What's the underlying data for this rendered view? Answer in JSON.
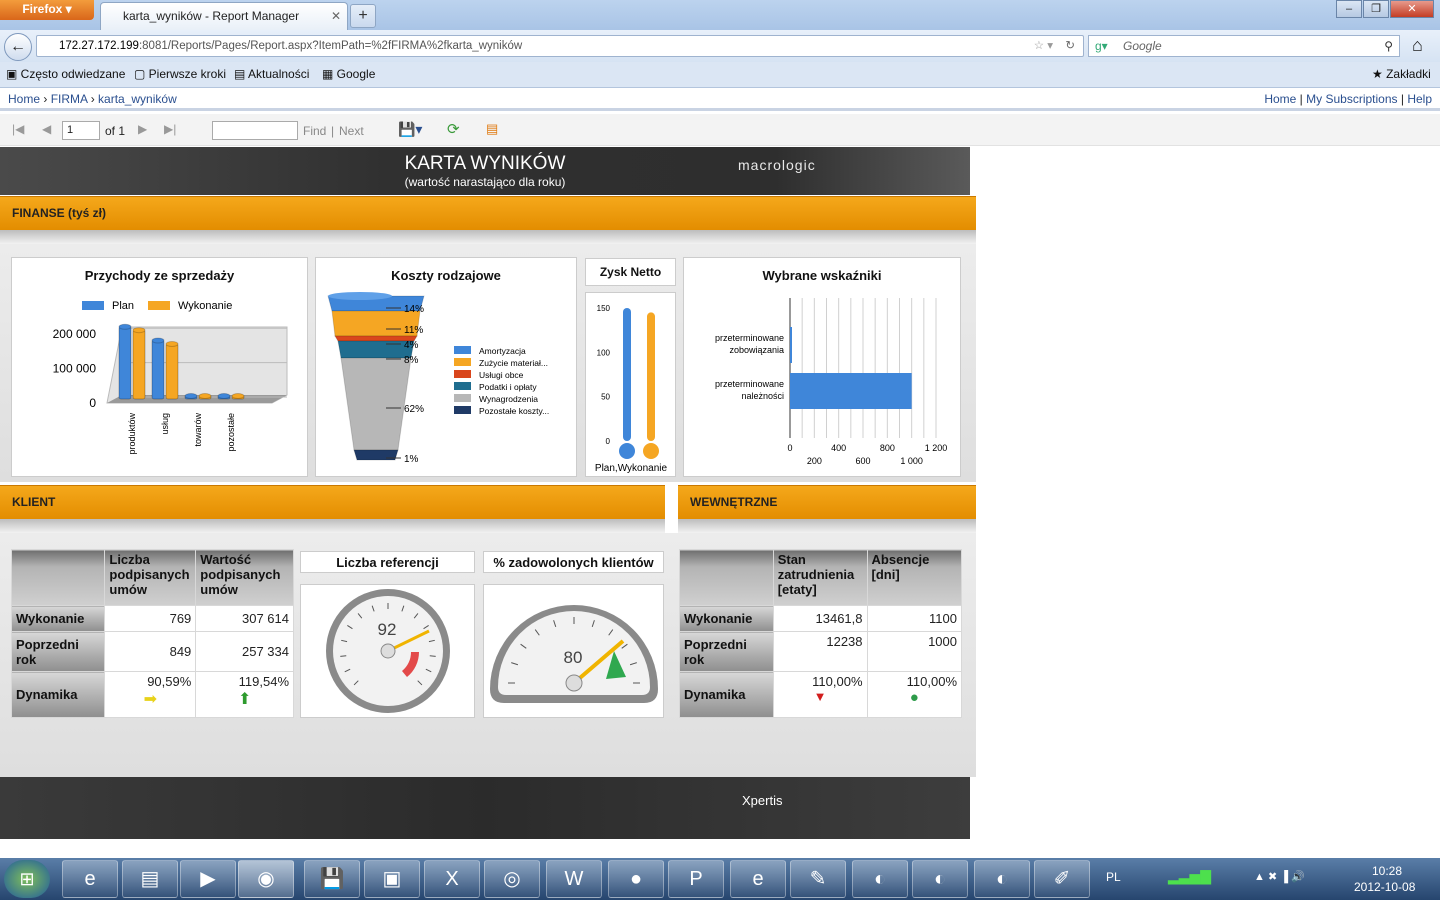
{
  "browser": {
    "app_button": "Firefox",
    "tab_title": "karta_wyników - Report Manager",
    "url_host": "172.27.172.199",
    "url_rest": ":8081/Reports/Pages/Report.aspx?ItemPath=%2fFIRMA%2fkarta_wyników",
    "search_placeholder": "Google",
    "bookmarks": [
      "Często odwiedzane",
      "Pierwsze kroki",
      "Aktualności",
      "Google"
    ],
    "bookmarks_menu": "Zakładki"
  },
  "rm": {
    "breadcrumb": [
      "Home",
      "FIRMA",
      "karta_wyników"
    ],
    "links": [
      "Home",
      "My Subscriptions",
      "Help"
    ],
    "page_value": "1",
    "of_label": "of 1",
    "find_label": "Find",
    "next_label": "Next"
  },
  "report": {
    "title": "KARTA WYNIKÓW",
    "subtitle": "(wartość narastająco dla roku)",
    "logo": "macrologic",
    "footer_logo": "Xpertis",
    "sections": {
      "finanse": "FINANSE (tyś zł)",
      "klient": "KLIENT",
      "wewnetrzne": "WEWNĘTRZNE"
    }
  },
  "colors": {
    "plan": "#3f86d9",
    "wykonanie": "#f5a623",
    "orange_band": "#eb9a0a"
  },
  "chart_data": [
    {
      "type": "bar",
      "title": "Przychody ze sprzedaży",
      "categories": [
        "produktów",
        "usług",
        "towarów",
        "pozostałe"
      ],
      "series": [
        {
          "name": "Plan",
          "values": [
            210000,
            170000,
            5000,
            5000
          ]
        },
        {
          "name": "Wykonanie",
          "values": [
            200000,
            160000,
            4000,
            4000
          ]
        }
      ],
      "yticks": [
        "200 000",
        "100 000",
        "0"
      ],
      "ylim": [
        0,
        250000
      ]
    },
    {
      "type": "funnel",
      "title": "Koszty rodzajowe",
      "labels": [
        "Amortyzacja",
        "Zużycie materiał...",
        "Usługi obce",
        "Podatki i opłaty",
        "Wynagrodzenia",
        "Pozostałe  koszty..."
      ],
      "values": [
        14,
        11,
        4,
        8,
        62,
        1
      ],
      "value_labels": [
        "14%",
        "11%",
        "4%",
        "8%",
        "62%",
        "1%"
      ],
      "colors": [
        "#3f86d9",
        "#f5a623",
        "#d9461c",
        "#1f6d8f",
        "#b7b7b7",
        "#1f3a66"
      ]
    },
    {
      "type": "bar",
      "title": "Zysk Netto",
      "categories": [
        "Plan",
        "Wykonanie"
      ],
      "values": [
        150,
        145
      ],
      "yticks": [
        "150",
        "100",
        "50",
        "0"
      ],
      "ylim": [
        0,
        150
      ],
      "xlabel": "Plan,Wykonanie"
    },
    {
      "type": "bar",
      "orientation": "horizontal",
      "title": "Wybrane wskaźniki",
      "categories": [
        "przeterminowane zobowiązania",
        "przeterminowane należności"
      ],
      "values": [
        5,
        1000
      ],
      "xticks_top": [
        "0",
        "400",
        "800",
        "1 200"
      ],
      "xticks_bottom": [
        "200",
        "600",
        "1 000"
      ],
      "xlim": [
        0,
        1200
      ]
    }
  ],
  "klient_table": {
    "headers": [
      "Liczba podpisanych umów",
      "Wartość podpisanych umów"
    ],
    "rows": [
      {
        "label": "Wykonanie",
        "values": [
          "769",
          "307 614"
        ]
      },
      {
        "label": "Poprzedni rok",
        "values": [
          "849",
          "257 334"
        ]
      },
      {
        "label": "Dynamika",
        "values": [
          "90,59%",
          "119,54%"
        ]
      }
    ]
  },
  "gauges": [
    {
      "title": "Liczba referencji",
      "value": "92"
    },
    {
      "title": "% zadowolonych klientów",
      "value": "80"
    }
  ],
  "wew_table": {
    "headers": [
      "Stan zatrudnienia [etaty]",
      "Absencje [dni]"
    ],
    "rows": [
      {
        "label": "Wykonanie",
        "values": [
          "13461,8",
          "1100"
        ]
      },
      {
        "label": "Poprzedni rok",
        "values": [
          "12238",
          "1000"
        ]
      },
      {
        "label": "Dynamika",
        "values": [
          "110,00%",
          "110,00%"
        ]
      }
    ]
  },
  "taskbar": {
    "lang": "PL",
    "time": "10:28",
    "date": "2012-10-08"
  }
}
